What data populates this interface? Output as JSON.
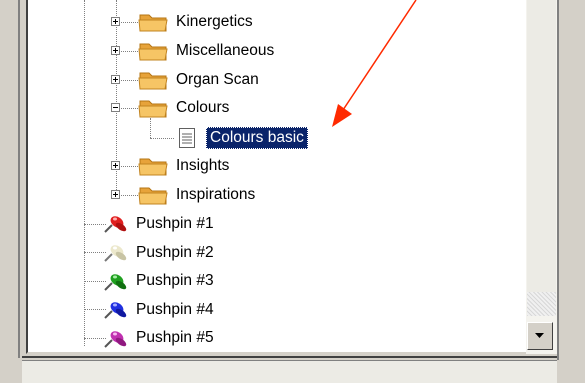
{
  "tree": {
    "folders": [
      {
        "label": "Kinergetics",
        "state": "collapsed"
      },
      {
        "label": "Miscellaneous",
        "state": "collapsed"
      },
      {
        "label": "Organ Scan",
        "state": "collapsed"
      },
      {
        "label": "Colours",
        "state": "expanded"
      },
      {
        "label": "Insights",
        "state": "collapsed"
      },
      {
        "label": "Inspirations",
        "state": "collapsed"
      }
    ],
    "selected_item": {
      "label": "Colours basic",
      "parent": "Colours",
      "icon": "document-icon"
    },
    "pushpins": [
      {
        "label": "Pushpin #1",
        "color": "#e02020"
      },
      {
        "label": "Pushpin #2",
        "color": "#e8e4c8"
      },
      {
        "label": "Pushpin #3",
        "color": "#20a020"
      },
      {
        "label": "Pushpin #4",
        "color": "#2030e0"
      },
      {
        "label": "Pushpin #5",
        "color": "#c030b0"
      }
    ]
  },
  "annotation": {
    "arrow_color": "#ff2a00",
    "points_to": "Colours basic"
  },
  "scrollbar": {
    "down_button_icon": "chevron-down-icon"
  },
  "colors": {
    "selection": "#0a246a",
    "folder": "#f2b24a",
    "window_face": "#d4d0c8"
  }
}
